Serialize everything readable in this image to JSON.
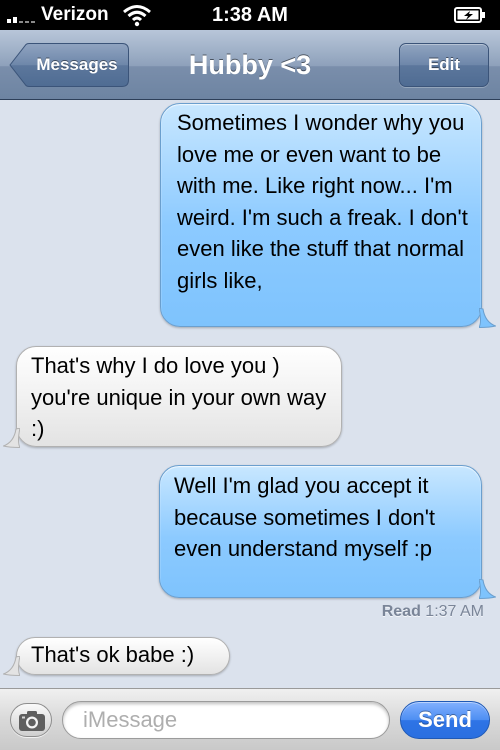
{
  "status_bar": {
    "carrier": "Verizon",
    "time": "1:38 AM"
  },
  "nav": {
    "back_label": "Messages",
    "title": "Hubby <3",
    "edit_label": "Edit"
  },
  "messages": [
    {
      "direction": "sent",
      "text": "Sometimes I wonder why you love me or even want to be with me. Like right now... I'm weird. I'm such a freak. I don't even like the stuff that normal girls like,"
    },
    {
      "direction": "received",
      "text": "That's why I do love you ) you're unique in your own way :)"
    },
    {
      "direction": "sent",
      "text": "Well I'm glad you accept it because sometimes I don't even understand myself :p"
    },
    {
      "direction": "received",
      "text": "That's ok babe :)"
    }
  ],
  "receipt": {
    "label": "Read",
    "time": "1:37 AM"
  },
  "composer": {
    "placeholder": "iMessage",
    "value": "",
    "send_label": "Send"
  },
  "icons": {
    "signal": "signal-bars-icon",
    "wifi": "wifi-icon",
    "battery": "battery-charging-icon",
    "back": "back-chevron-button",
    "camera": "camera-icon"
  },
  "colors": {
    "conversation_background": "#dbe2ed",
    "sent_bubble": "#8ccaff",
    "received_bubble": "#f0f0f0",
    "send_button": "#2e74e6",
    "nav_bar": "#8ea1bb"
  }
}
